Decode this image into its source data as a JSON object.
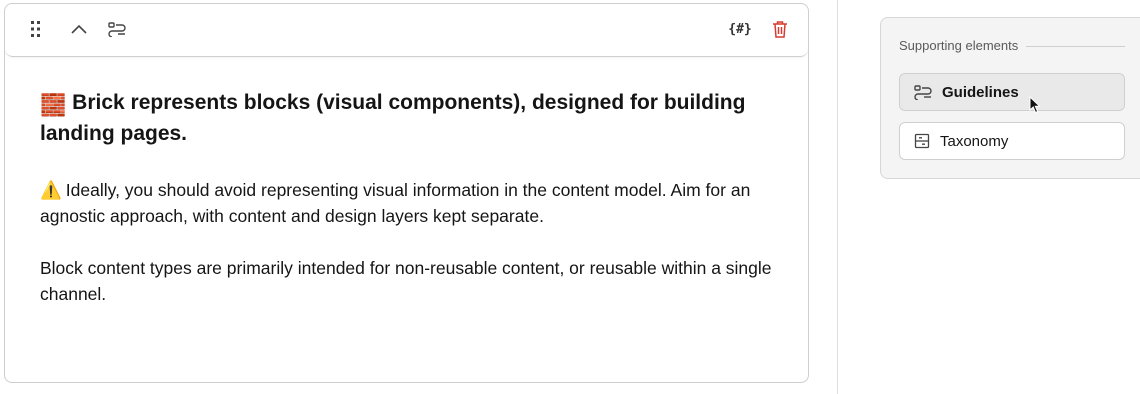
{
  "editor": {
    "toolbar": {
      "drag_icon": "drag-handle-icon",
      "collapse_icon": "chevron-up-icon",
      "guidelines_icon": "guidelines-icon",
      "snippet_icon": "curly-hash-icon",
      "delete_icon": "trash-icon",
      "delete_color": "#d63b2f",
      "snippet_label": "{#}"
    },
    "heading_emoji": "🧱",
    "heading": "Brick represents blocks (visual components), designed for building landing pages.",
    "warning_emoji": "⚠️",
    "paragraph_1": "Ideally, you should avoid representing visual information in the content model. Aim for an agnostic approach, with content and design layers kept separate.",
    "paragraph_2": "Block content types are primarily intended for non-reusable content, or reusable within a single channel."
  },
  "sidebar": {
    "title": "Supporting elements",
    "items": [
      {
        "label": "Guidelines",
        "icon": "guidelines-icon",
        "active": true
      },
      {
        "label": "Taxonomy",
        "icon": "taxonomy-icon",
        "active": false
      }
    ]
  }
}
